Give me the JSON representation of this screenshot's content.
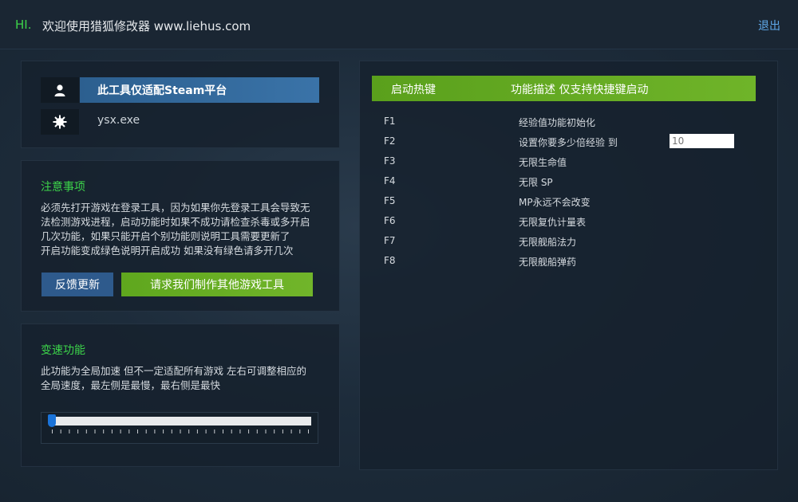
{
  "titlebar": {
    "hi": "HI.",
    "welcome": "欢迎使用猎狐修改器 www.liehus.com",
    "logout": "退出"
  },
  "info": {
    "user_icon": "user-icon",
    "process_icon": "gear-icon",
    "platform": "此工具仅适配Steam平台",
    "process": "ysx.exe"
  },
  "notes": {
    "title": "注意事项",
    "lines": [
      "必须先打开游戏在登录工具，因为如果你先登录工具会导致无",
      "法检测游戏进程，启动功能时如果不成功请检查杀毒或多开启",
      "几次功能，如果只能开启个别功能则说明工具需要更新了",
      "开启功能变成绿色说明开启成功 如果没有绿色请多开几次"
    ],
    "feedback_button": "反馈更新",
    "request_button": "请求我们制作其他游戏工具"
  },
  "speed": {
    "title": "变速功能",
    "lines": [
      "此功能为全局加速 但不一定适配所有游戏 左右可调整相应的",
      "全局速度，最左侧是最慢，最右侧是最快"
    ],
    "value": 0
  },
  "hotkeys": {
    "header_key": "启动热键",
    "header_desc": "功能描述 仅支持快捷键启动",
    "rows": [
      {
        "key": "F1",
        "desc": "经验值功能初始化"
      },
      {
        "key": "F2",
        "desc": "设置你要多少倍经验 到"
      },
      {
        "key": "F3",
        "desc": "无限生命值"
      },
      {
        "key": "F4",
        "desc": "无限 SP"
      },
      {
        "key": "F5",
        "desc": "MP永远不会改变"
      },
      {
        "key": "F6",
        "desc": "无限复仇计量表"
      },
      {
        "key": "F7",
        "desc": "无限舰船法力"
      },
      {
        "key": "F8",
        "desc": "无限舰船弹药"
      }
    ],
    "exp_placeholder": "10"
  },
  "colors": {
    "accent_green": "#3cd44a",
    "button_blue": "#2e5a8c",
    "button_green": "#6fb429",
    "link_blue": "#5fa8e8"
  }
}
